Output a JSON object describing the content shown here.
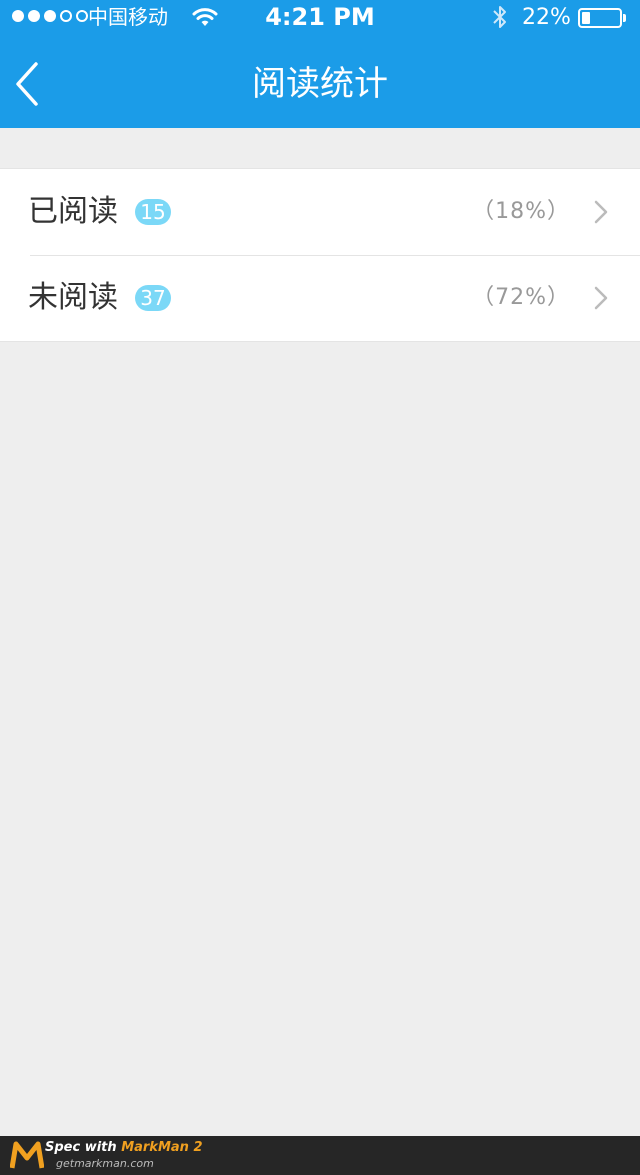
{
  "status_bar": {
    "signal_bars": 5,
    "signal_filled": 3,
    "carrier": "中国移动",
    "time": "4:21 PM",
    "battery_percent": "22%",
    "battery_level": 0.22
  },
  "nav": {
    "title": "阅读统计",
    "back_icon": "chevron-left-icon"
  },
  "list": {
    "rows": [
      {
        "label": "已阅读",
        "count": "15",
        "percent": "（18%）"
      },
      {
        "label": "未阅读",
        "count": "37",
        "percent": "（72%）"
      }
    ]
  },
  "colors": {
    "header": "#1b9ce8",
    "label_text": "#333333",
    "percent_text": "#999999",
    "badge_bg": "#7bd8f7",
    "badge_text": "#ffffff",
    "divider": "#e4e4e4",
    "page_bg": "#eeeeee"
  },
  "footer": {
    "prefix": "Spec with ",
    "brand": "MarkMan 2",
    "site": "getmarkman.com"
  }
}
